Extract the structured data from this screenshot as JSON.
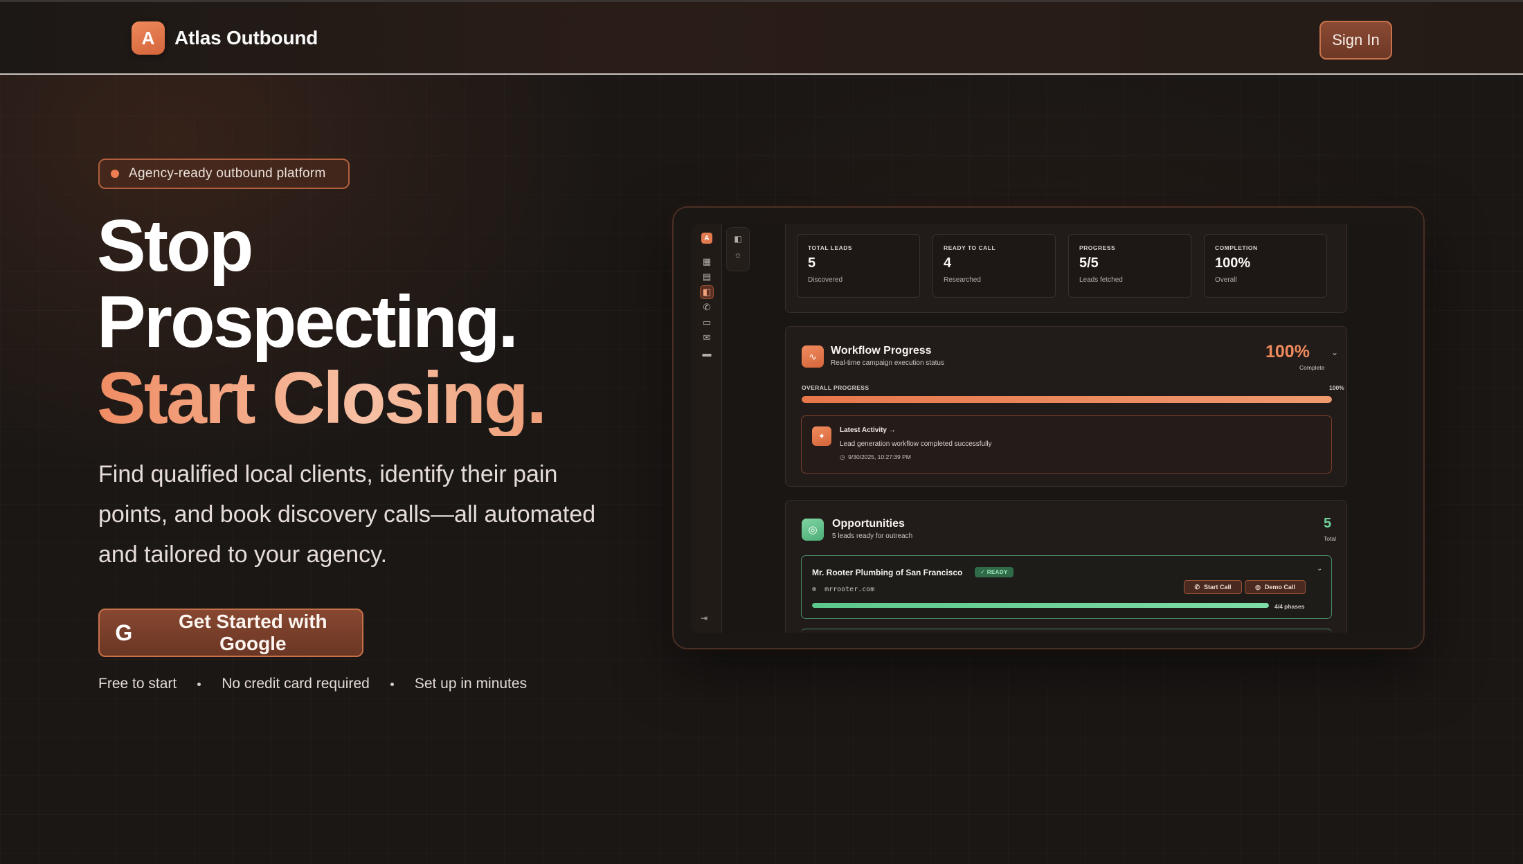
{
  "nav": {
    "logo_letter": "A",
    "brand": "Atlas Outbound",
    "signin_label": "Sign In"
  },
  "hero": {
    "pill": "Agency-ready outbound platform",
    "headline_line1": "Stop",
    "headline_line2": "Prospecting.",
    "headline_line3": "Start Closing.",
    "subtext": "Find qualified local clients, identify their pain points, and book discovery calls—all automated and tailored to your agency.",
    "cta_label": "Get Started with Google",
    "cta_icon": "G",
    "perks": [
      "Free to start",
      "No credit card required",
      "Set up in minutes"
    ]
  },
  "preview": {
    "rail_logo": "A",
    "stats": [
      {
        "label": "TOTAL LEADS",
        "value": "5",
        "sub": "Discovered"
      },
      {
        "label": "READY TO CALL",
        "value": "4",
        "sub": "Researched"
      },
      {
        "label": "PROGRESS",
        "value": "5/5",
        "sub": "Leads fetched"
      },
      {
        "label": "COMPLETION",
        "value": "100%",
        "sub": "Overall"
      }
    ],
    "workflow": {
      "title": "Workflow Progress",
      "subtitle": "Real-time campaign execution status",
      "percent": "100%",
      "percent_sub": "Complete",
      "overall_label": "OVERALL PROGRESS",
      "overall_pct": "100%",
      "progress_fraction": 1.0,
      "activity_title": "Latest Activity  →",
      "activity_desc": "Lead generation workflow completed successfully",
      "activity_time": "9/30/2025, 10:27:39 PM"
    },
    "opportunities": {
      "title": "Opportunities",
      "subtitle": "5 leads ready for outreach",
      "count": "5",
      "count_sub": "Total",
      "lead_name": "Mr. Rooter Plumbing of San Francisco",
      "lead_badge": "READY",
      "lead_url": "mrrooter.com",
      "start_call": "Start Call",
      "demo_call": "Demo Call",
      "phases": "4/4 phases",
      "phase_fraction": 1.0
    }
  },
  "colors": {
    "accent": "#e7774b",
    "success": "#5cc88c",
    "background": "#1b1715"
  }
}
